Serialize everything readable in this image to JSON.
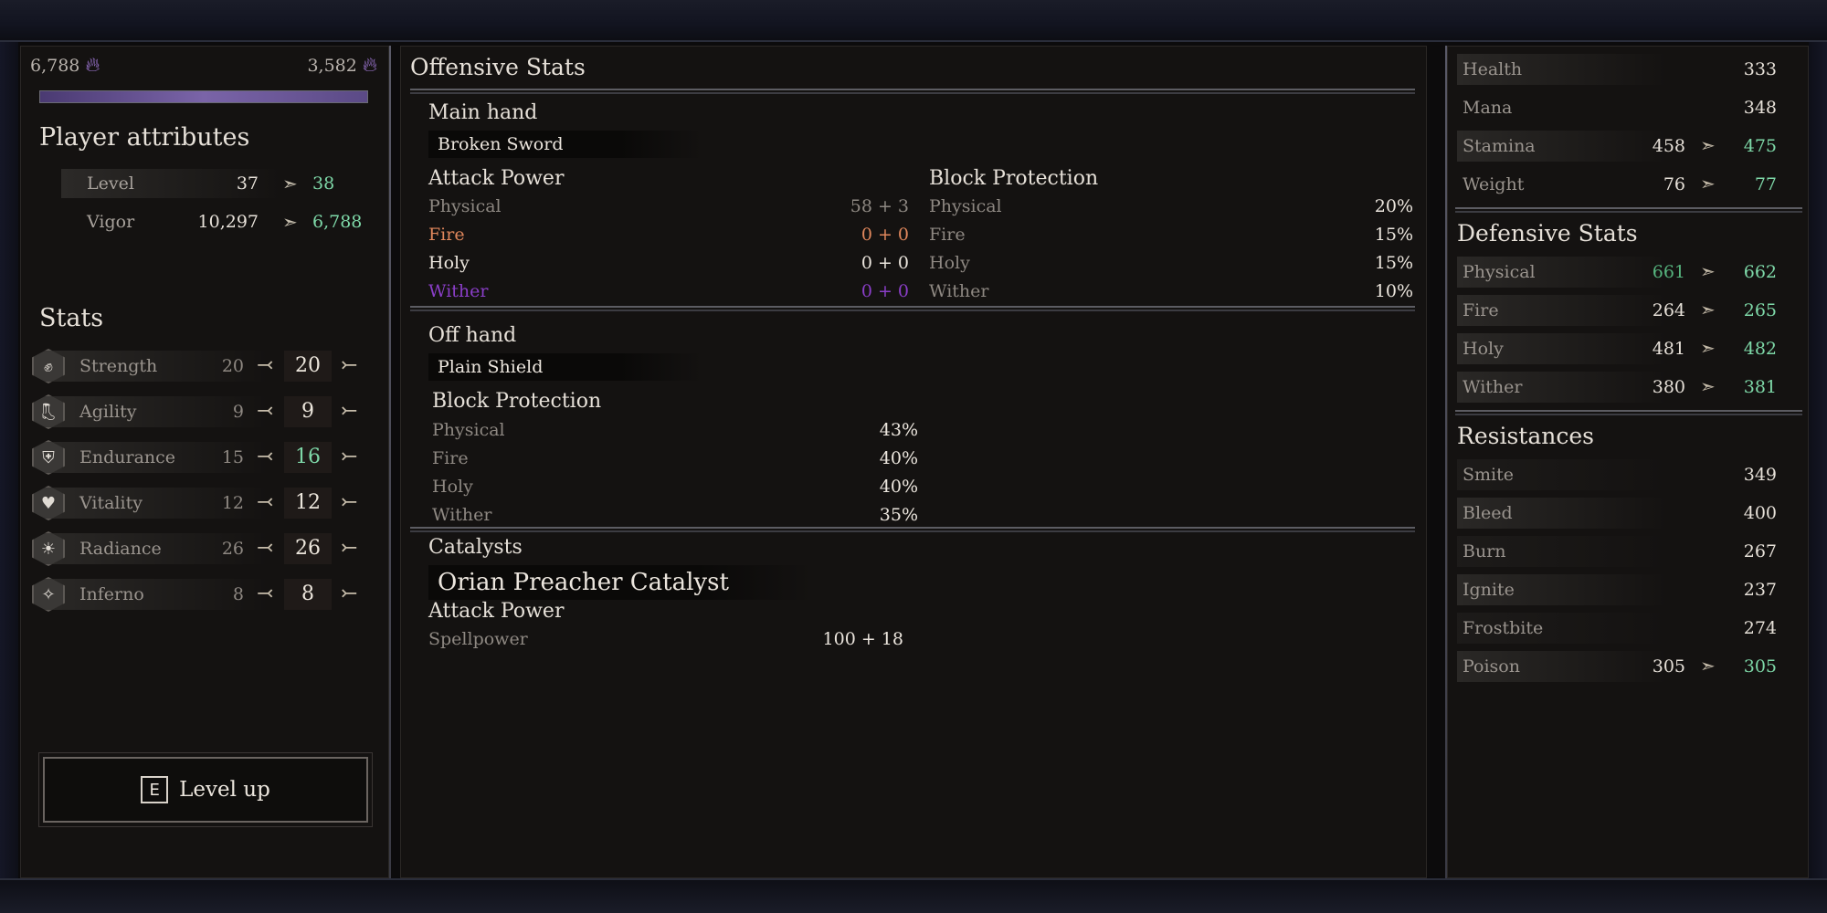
{
  "currency": {
    "left": "6,788",
    "right": "3,582",
    "xp_progress": 1.0
  },
  "player_attributes": {
    "title": "Player attributes",
    "rows": [
      {
        "label": "Level",
        "current": "37",
        "next": "38"
      },
      {
        "label": "Vigor",
        "current": "10,297",
        "next": "6,788"
      }
    ]
  },
  "stats": {
    "title": "Stats",
    "rows": [
      {
        "label": "Strength",
        "base": "20",
        "value": "20",
        "icon": "fist-icon"
      },
      {
        "label": "Agility",
        "base": "9",
        "value": "9",
        "icon": "boot-icon"
      },
      {
        "label": "Endurance",
        "base": "15",
        "value": "16",
        "icon": "armor-icon"
      },
      {
        "label": "Vitality",
        "base": "12",
        "value": "12",
        "icon": "heart-icon"
      },
      {
        "label": "Radiance",
        "base": "26",
        "value": "26",
        "icon": "sun-icon"
      },
      {
        "label": "Inferno",
        "base": "8",
        "value": "8",
        "icon": "flame-icon"
      }
    ]
  },
  "level_up": {
    "key": "E",
    "label": "Level up"
  },
  "offensive": {
    "title": "Offensive Stats",
    "main_hand": {
      "title": "Main hand",
      "item": "Broken Sword",
      "attack_title": "Attack Power",
      "attack": [
        {
          "label": "Physical",
          "value": "58 + 3"
        },
        {
          "label": "Fire",
          "value": "0 + 0"
        },
        {
          "label": "Holy",
          "value": "0 + 0"
        },
        {
          "label": "Wither",
          "value": "0 + 0"
        }
      ],
      "block_title": "Block Protection",
      "block": [
        {
          "label": "Physical",
          "value": "20%"
        },
        {
          "label": "Fire",
          "value": "15%"
        },
        {
          "label": "Holy",
          "value": "15%"
        },
        {
          "label": "Wither",
          "value": "10%"
        }
      ]
    },
    "off_hand": {
      "title": "Off hand",
      "item": "Plain Shield",
      "block_title": "Block Protection",
      "block": [
        {
          "label": "Physical",
          "value": "43%"
        },
        {
          "label": "Fire",
          "value": "40%"
        },
        {
          "label": "Holy",
          "value": "40%"
        },
        {
          "label": "Wither",
          "value": "35%"
        }
      ]
    },
    "catalysts": {
      "title": "Catalysts",
      "item": "Orian Preacher Catalyst",
      "attack_title": "Attack Power",
      "attack": [
        {
          "label": "Spellpower",
          "value": "100 + 18"
        }
      ]
    }
  },
  "vitals": [
    {
      "label": "Health",
      "value": "333"
    },
    {
      "label": "Mana",
      "value": "348"
    },
    {
      "label": "Stamina",
      "current": "458",
      "next": "475"
    },
    {
      "label": "Weight",
      "current": "76",
      "next": "77"
    }
  ],
  "defensive": {
    "title": "Defensive Stats",
    "rows": [
      {
        "label": "Physical",
        "current": "661",
        "next": "662"
      },
      {
        "label": "Fire",
        "current": "264",
        "next": "265"
      },
      {
        "label": "Holy",
        "current": "481",
        "next": "482"
      },
      {
        "label": "Wither",
        "current": "380",
        "next": "381"
      }
    ]
  },
  "resistances": {
    "title": "Resistances",
    "rows": [
      {
        "label": "Smite",
        "value": "349"
      },
      {
        "label": "Bleed",
        "value": "400"
      },
      {
        "label": "Burn",
        "value": "267"
      },
      {
        "label": "Ignite",
        "value": "237"
      },
      {
        "label": "Frostbite",
        "value": "274"
      },
      {
        "label": "Poison",
        "current": "305",
        "next": "305"
      }
    ]
  },
  "colors": {
    "fire": "#e0875c",
    "wither": "#8a3ec8",
    "increase": "#7ed8a8",
    "xp": "#7a64a8"
  }
}
